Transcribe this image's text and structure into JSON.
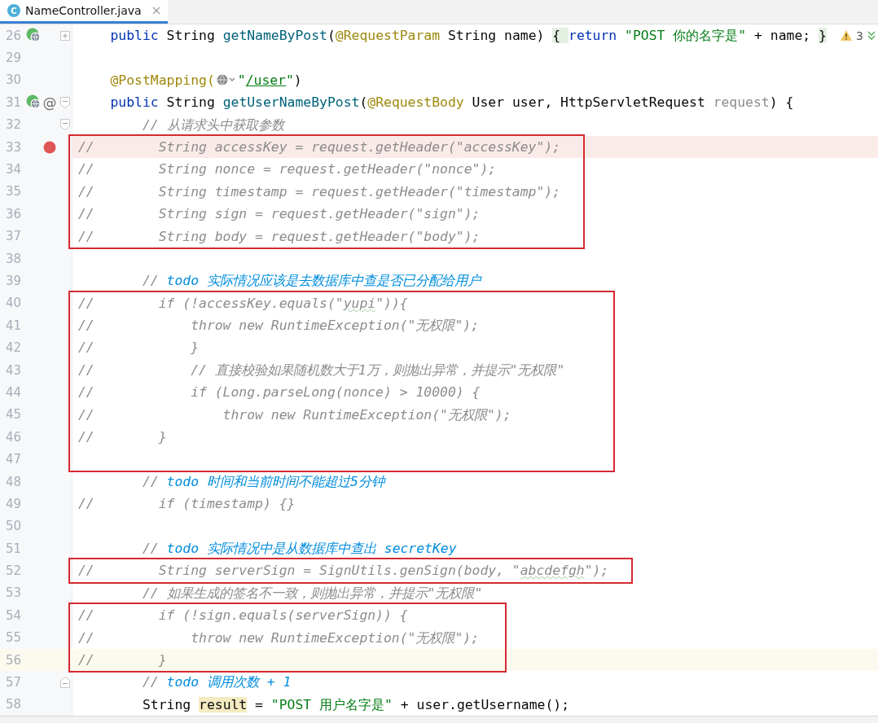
{
  "tabs": [
    {
      "icon_letter": "C",
      "title": "NameController.java",
      "selected": true
    }
  ],
  "editor": {
    "blocks": [
      {
        "lines": [
          {
            "number": "26",
            "gutter_icons": [
              {
                "kind": "endpoint"
              }
            ],
            "fold": {
              "kind": "expand"
            },
            "inspection_count": "3",
            "tokens": [
              {
                "text": "    public",
                "kind": "kw"
              },
              {
                "text": " String ",
                "kind": "plain"
              },
              {
                "text": "getNameByPost",
                "kind": "method"
              },
              {
                "text": "(",
                "kind": "plain"
              },
              {
                "text": "@RequestParam",
                "kind": "anno"
              },
              {
                "text": " String name) ",
                "kind": "plain"
              },
              {
                "text": "{ ",
                "kind": "fold"
              },
              {
                "text": "return",
                "kind": "kw"
              },
              {
                "text": " \"POST 你的名字是\"",
                "kind": "str"
              },
              {
                "text": " + name; ",
                "kind": "plain"
              },
              {
                "text": "}",
                "kind": "fold"
              }
            ]
          },
          {
            "number": "29"
          },
          {
            "number": "30",
            "tokens": [
              {
                "text": "    @PostMapping(",
                "kind": "anno"
              },
              {
                "kind": "inlay"
              },
              {
                "text": "\"",
                "kind": "str"
              },
              {
                "text": "/user",
                "kind": "link"
              },
              {
                "text": "\"",
                "kind": "str"
              },
              {
                "text": ")",
                "kind": "plain"
              }
            ]
          },
          {
            "number": "31",
            "gutter_icons": [
              {
                "kind": "endpoint"
              }
            ],
            "gutter_symbol": "@",
            "fold": {
              "kind": "collapse"
            },
            "tokens": [
              {
                "text": "    public",
                "kind": "kw"
              },
              {
                "text": " String ",
                "kind": "plain"
              },
              {
                "text": "getUserNameByPost",
                "kind": "method"
              },
              {
                "text": "(",
                "kind": "plain"
              },
              {
                "text": "@RequestBody",
                "kind": "anno"
              },
              {
                "text": " User user, HttpServletRequest ",
                "kind": "plain"
              },
              {
                "text": "request",
                "kind": "unused"
              },
              {
                "text": ") {",
                "kind": "plain"
              }
            ]
          },
          {
            "number": "32",
            "fold": {
              "kind": "collapse"
            },
            "tokens": [
              {
                "text": "        // 从请求头中获取参数",
                "kind": "comment"
              }
            ]
          }
        ]
      },
      {
        "framed": true,
        "lines": [
          {
            "number": "33",
            "breakpoint_hit": true,
            "gutter_icons": [
              {
                "kind": "breakpoint"
              }
            ],
            "tokens": [
              {
                "text": "//        String accessKey = request.getHeader(\"accessKey\");",
                "kind": "comment"
              }
            ]
          },
          {
            "number": "34",
            "tokens": [
              {
                "text": "//        String nonce = request.getHeader(\"nonce\");",
                "kind": "comment"
              }
            ]
          },
          {
            "number": "35",
            "tokens": [
              {
                "text": "//        String timestamp = request.getHeader(\"timestamp\");",
                "kind": "comment"
              }
            ]
          },
          {
            "number": "36",
            "tokens": [
              {
                "text": "//        String sign = request.getHeader(\"sign\");",
                "kind": "comment"
              }
            ]
          },
          {
            "number": "37",
            "tokens": [
              {
                "text": "//        String body = request.getHeader(\"body\");",
                "kind": "comment"
              }
            ]
          }
        ]
      },
      {
        "lines": [
          {
            "number": "38"
          },
          {
            "number": "39",
            "tokens": [
              {
                "text": "        // ",
                "kind": "comment"
              },
              {
                "text": "todo 实际情况应该是去数据库中查是否已分配给用户",
                "kind": "todo"
              }
            ]
          }
        ]
      },
      {
        "framed": true,
        "lines": [
          {
            "number": "40",
            "tokens": [
              {
                "text": "//        if (!accessKey.equals(\"",
                "kind": "comment"
              },
              {
                "text": "yupi",
                "kind": "typo"
              },
              {
                "text": "\")){",
                "kind": "comment"
              }
            ]
          },
          {
            "number": "41",
            "tokens": [
              {
                "text": "//            throw new RuntimeException(\"无权限\");",
                "kind": "comment"
              }
            ]
          },
          {
            "number": "42",
            "tokens": [
              {
                "text": "//            }",
                "kind": "comment"
              }
            ]
          },
          {
            "number": "43",
            "tokens": [
              {
                "text": "//            // 直接校验如果随机数大于1万，则抛出异常，并提示\"无权限\"",
                "kind": "comment"
              }
            ]
          },
          {
            "number": "44",
            "tokens": [
              {
                "text": "//            if (Long.parseLong(nonce) > 10000) {",
                "kind": "comment"
              }
            ]
          },
          {
            "number": "45",
            "tokens": [
              {
                "text": "//                throw new RuntimeException(\"无权限\");",
                "kind": "comment"
              }
            ]
          },
          {
            "number": "46",
            "tokens": [
              {
                "text": "//        }",
                "kind": "comment"
              }
            ]
          },
          {
            "number": "47"
          }
        ]
      },
      {
        "lines": [
          {
            "number": "48",
            "tokens": [
              {
                "text": "        // ",
                "kind": "comment"
              },
              {
                "text": "todo 时间和当前时间不能超过5分钟",
                "kind": "todo"
              }
            ]
          },
          {
            "number": "49",
            "tokens": [
              {
                "text": "//        if (timestamp) {}",
                "kind": "comment"
              }
            ]
          },
          {
            "number": "50"
          },
          {
            "number": "51",
            "tokens": [
              {
                "text": "        // ",
                "kind": "comment"
              },
              {
                "text": "todo 实际情况中是从数据库中查出 secretKey",
                "kind": "todo"
              }
            ]
          }
        ]
      },
      {
        "framed": true,
        "lines": [
          {
            "number": "52",
            "tokens": [
              {
                "text": "//        String serverSign = SignUtils.genSign(body, \"",
                "kind": "comment"
              },
              {
                "text": "abcdefgh",
                "kind": "typo"
              },
              {
                "text": "\");",
                "kind": "comment"
              }
            ]
          }
        ]
      },
      {
        "lines": [
          {
            "number": "53",
            "tokens": [
              {
                "text": "        // 如果生成的签名不一致，则抛出异常，并提示\"无权限\"",
                "kind": "comment"
              }
            ]
          }
        ]
      },
      {
        "framed": true,
        "lines": [
          {
            "number": "54",
            "tokens": [
              {
                "text": "//        if (!sign.equals(serverSign)) {",
                "kind": "comment"
              }
            ]
          },
          {
            "number": "55",
            "tokens": [
              {
                "text": "//            throw new RuntimeException(\"无权限\");",
                "kind": "comment"
              }
            ]
          },
          {
            "number": "56",
            "current": true,
            "tokens": [
              {
                "text": "//        }",
                "kind": "comment"
              }
            ]
          }
        ]
      },
      {
        "lines": [
          {
            "number": "57",
            "fold": {
              "kind": "end"
            },
            "tokens": [
              {
                "text": "        // ",
                "kind": "comment"
              },
              {
                "text": "todo 调用次数 + 1",
                "kind": "todo"
              }
            ]
          },
          {
            "number": "58",
            "tokens": [
              {
                "text": "        String ",
                "kind": "plain"
              },
              {
                "text": "result",
                "kind": "hl"
              },
              {
                "text": " = ",
                "kind": "plain"
              },
              {
                "text": "\"POST 用户名字是\"",
                "kind": "str"
              },
              {
                "text": " + user.getUsername();",
                "kind": "plain"
              }
            ]
          }
        ]
      }
    ]
  }
}
